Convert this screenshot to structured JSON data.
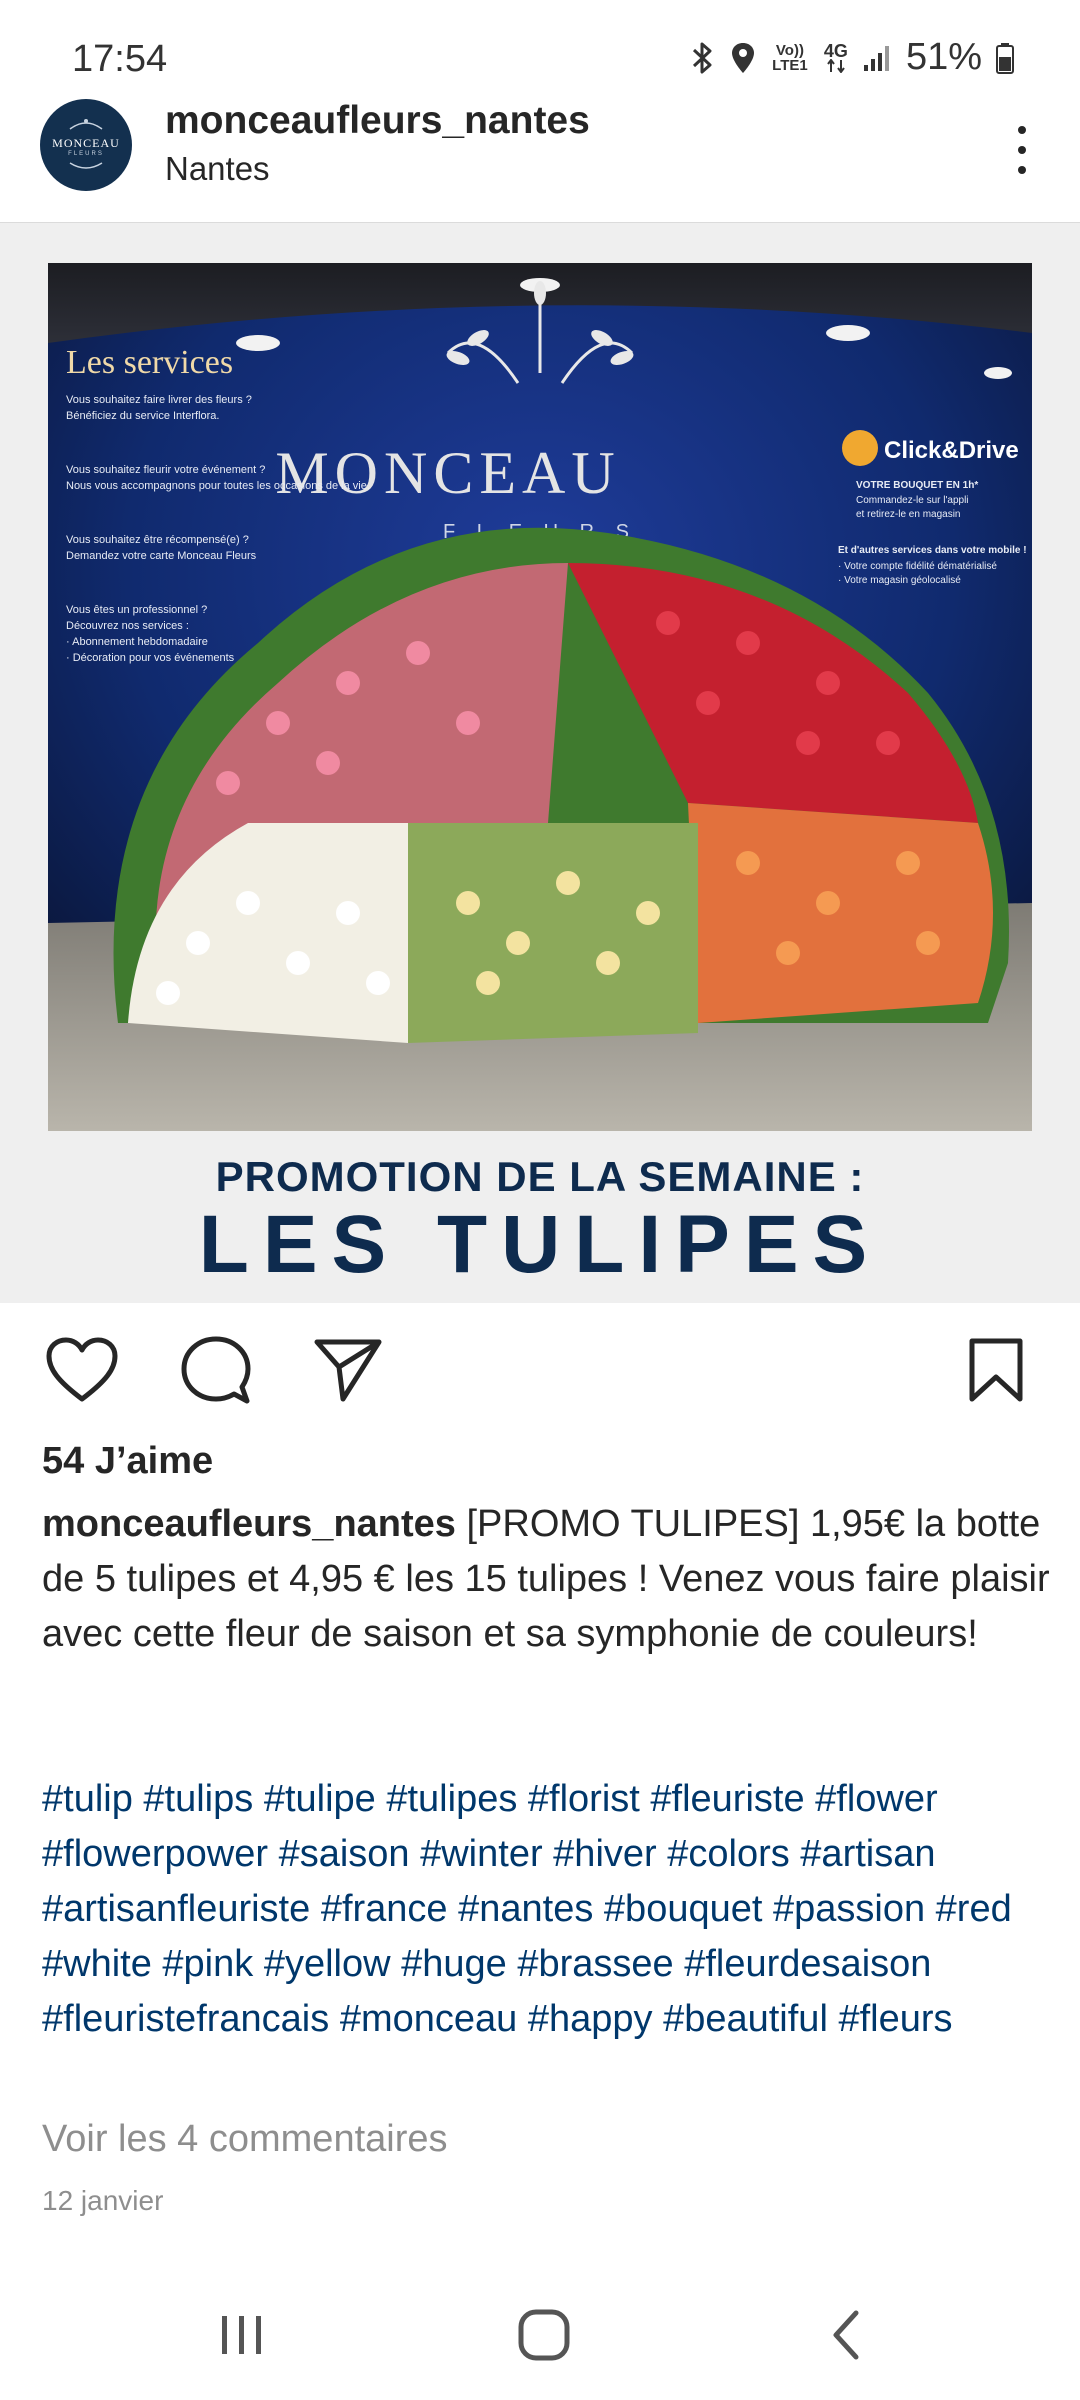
{
  "status_bar": {
    "time": "17:54",
    "volte_label": "Vo)) LTE1",
    "network_label": "4G",
    "battery_text": "51%"
  },
  "post": {
    "username": "monceaufleurs_nantes",
    "location": "Nantes",
    "avatar_text": "MONCEAU",
    "avatar_sub": "FLEURS",
    "image": {
      "promo_line1": "PROMOTION DE LA SEMAINE :",
      "promo_line2": "LES TULIPES",
      "signage": {
        "brand": "MONCEAU",
        "brand_sub": "F L E U R S",
        "services_title": "Les services",
        "services_lines": [
          "Vous souhaitez faire livrer des fleurs ?",
          "Bénéficiez du service Interflora.",
          "Vous souhaitez fleurir votre événement ?",
          "Nous vous accompagnons pour toutes les occasions de la vie.",
          "Vous souhaitez être récompensé(e) ?",
          "Demandez votre carte Monceau Fleurs",
          "Vous êtes un professionnel ?",
          "Découvrez nos services :",
          "· Abonnement hebdomadaire",
          "· Décoration pour vos événements"
        ],
        "click_drive_title": "Click&Drive",
        "click_drive_lines": [
          "VOTRE BOUQUET EN 1h*",
          "Commandez-le sur l'appli",
          "et retirez-le en magasin",
          "Et d'autres services dans votre mobile !",
          "· Votre compte fidélité dématérialisé",
          "· Votre magasin géolocalisé"
        ]
      }
    },
    "likes": "54 J’aime",
    "caption_user": "monceaufleurs_nantes",
    "caption_text": "[PROMO TULIPES] 1,95€ la botte de 5 tulipes et 4,95 € les 15 tulipes ! Venez vous faire plaisir avec cette fleur de saison et sa symphonie de couleurs!",
    "hashtags": [
      "#tulip",
      "#tulips",
      "#tulipe",
      "#tulipes",
      "#florist",
      "#fleuriste",
      "#flower",
      "#flowerpower",
      "#saison",
      "#winter",
      "#hiver",
      "#colors",
      "#artisan",
      "#artisanfleuriste",
      "#france",
      "#nantes",
      "#bouquet",
      "#passion",
      "#red",
      "#white",
      "#pink",
      "#yellow",
      "#huge",
      "#brassee",
      "#fleurdesaison",
      "#fleuristefrancais",
      "#monceau",
      "#happy",
      "#beautiful",
      "#fleurs"
    ],
    "comments_link": "Voir les 4 commentaires",
    "date": "12 janvier"
  },
  "icons": {
    "like": "heart-icon",
    "comment": "comment-icon",
    "share": "send-icon",
    "save": "bookmark-icon",
    "more": "more-vertical-icon"
  },
  "colors": {
    "brand_navy": "#0e2b4e",
    "hashtag_blue": "#00376b",
    "muted_gray": "#8e8e8e",
    "media_bg": "#efefef"
  }
}
